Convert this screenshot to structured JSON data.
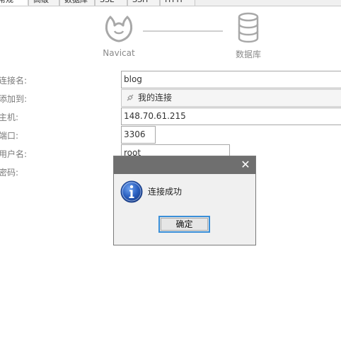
{
  "tabs": [
    {
      "label": "常规"
    },
    {
      "label": "高级"
    },
    {
      "label": "数据库"
    },
    {
      "label": "SSL"
    },
    {
      "label": "SSH"
    },
    {
      "label": "HTTP"
    }
  ],
  "header": {
    "left_label": "Navicat",
    "right_label": "数据库",
    "left_icon": "navicat-logo-icon",
    "right_icon": "database-icon"
  },
  "form": {
    "connection_name_label": "连接名:",
    "connection_name_value": "blog",
    "add_to_label": "添加到:",
    "add_to_value": "我的连接",
    "host_label": "主机:",
    "host_value": "148.70.61.215",
    "port_label": "端口:",
    "port_value": "3306",
    "username_label": "用户名:",
    "username_value": "root",
    "password_label": "密码:"
  },
  "dialog": {
    "message": "连接成功",
    "ok_label": "确定",
    "icon": "info-icon",
    "close_icon": "close-icon"
  },
  "colors": {
    "dialog_title_bar": "#6f6f6f",
    "focus_border": "#3a8fd8",
    "info_blue": "#2a5fc0"
  }
}
